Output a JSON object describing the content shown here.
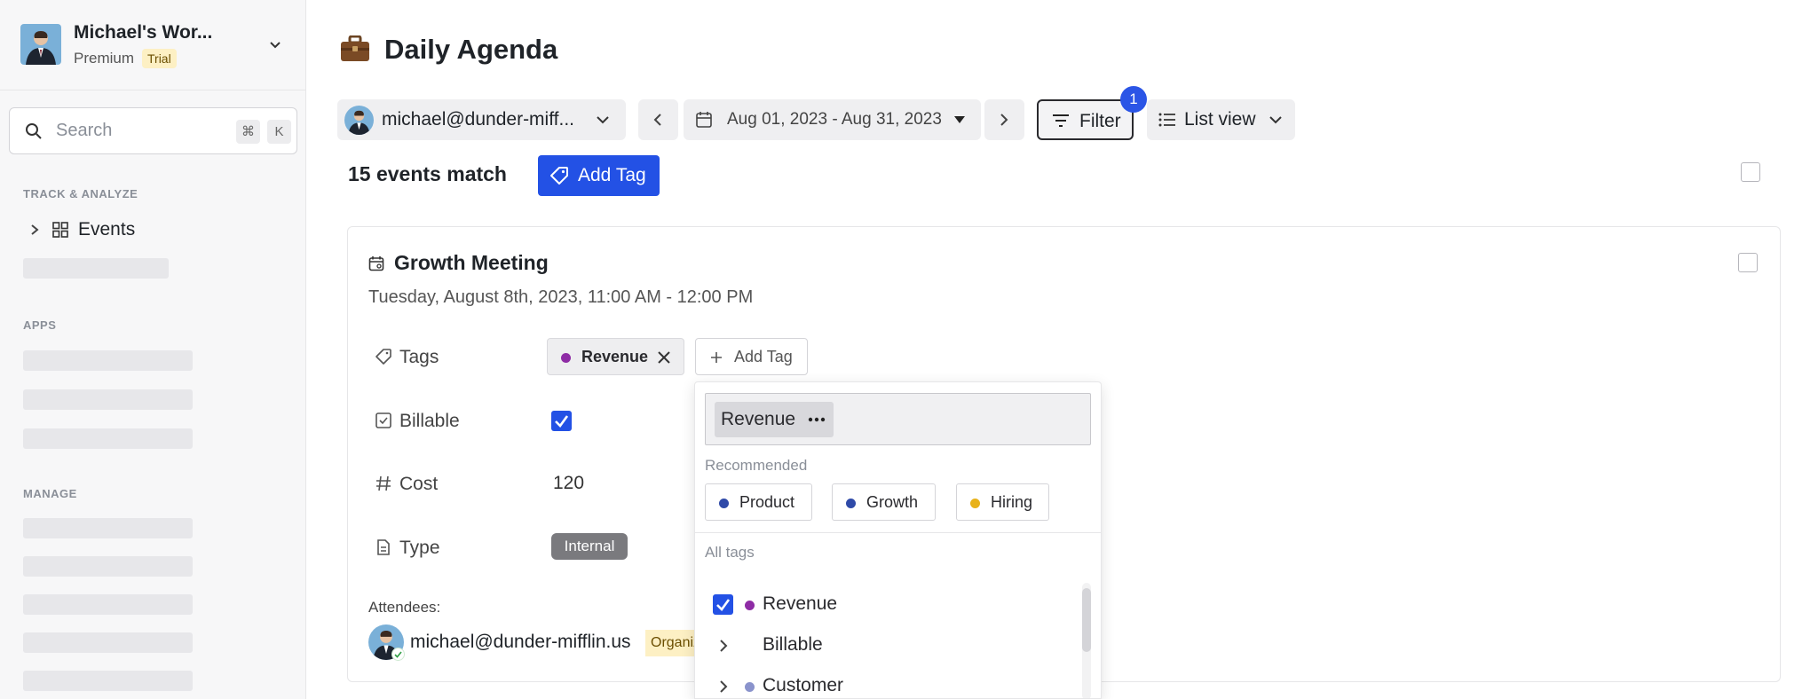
{
  "workspace": {
    "name": "Michael's Wor...",
    "plan": "Premium",
    "badge": "Trial"
  },
  "search": {
    "placeholder": "Search",
    "shortcut_mod": "⌘",
    "shortcut_key": "K"
  },
  "sidebar": {
    "section_track": "TRACK & ANALYZE",
    "events_label": "Events",
    "section_apps": "APPS",
    "section_manage": "MANAGE"
  },
  "header": {
    "title": "Daily Agenda",
    "user": "michael@dunder-miff...",
    "date_range": "Aug 01, 2023 - Aug 31, 2023",
    "filter_label": "Filter",
    "filter_count": "1",
    "view_label": "List view"
  },
  "toolbar": {
    "match_text": "15 events match",
    "add_tag_label": "Add Tag"
  },
  "event": {
    "title": "Growth Meeting",
    "datetime": "Tuesday, August 8th, 2023, 11:00 AM - 12:00 PM",
    "props": {
      "tags_label": "Tags",
      "billable_label": "Billable",
      "cost_label": "Cost",
      "type_label": "Type"
    },
    "tag": "Revenue",
    "add_tag_label": "Add Tag",
    "billable": true,
    "cost": "120",
    "type": "Internal",
    "attendees_label": "Attendees:",
    "attendee_email": "michael@dunder-mifflin.us",
    "attendee_role": "Organizer"
  },
  "tag_dropdown": {
    "selected_token": "Revenue",
    "recommended_label": "Recommended",
    "recommended": [
      {
        "name": "Product",
        "color": "#2f4aa8"
      },
      {
        "name": "Growth",
        "color": "#2f4aa8"
      },
      {
        "name": "Hiring",
        "color": "#e8b21a"
      }
    ],
    "all_tags_label": "All tags",
    "all_tags": [
      {
        "name": "Revenue",
        "color": "#8e2ca5",
        "checked": true
      },
      {
        "name": "Billable",
        "color": "",
        "expandable": true
      },
      {
        "name": "Customer",
        "color": "#8a93cc",
        "expandable": true
      }
    ]
  },
  "colors": {
    "accent": "#2351e5",
    "revenue": "#8e2ca5",
    "trial_bg": "#fdf0c4"
  }
}
